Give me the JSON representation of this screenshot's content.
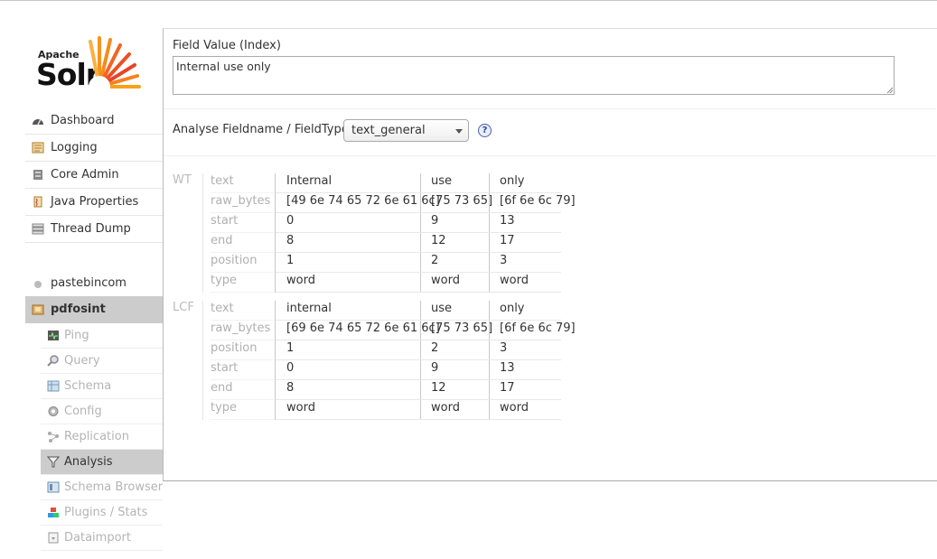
{
  "logo": {
    "apache": "Apache",
    "solr": "Solr"
  },
  "sidebar": {
    "items": [
      {
        "label": "Dashboard",
        "icon": "dashboard-icon"
      },
      {
        "label": "Logging",
        "icon": "logging-icon"
      },
      {
        "label": "Core Admin",
        "icon": "core-admin-icon"
      },
      {
        "label": "Java Properties",
        "icon": "java-properties-icon"
      },
      {
        "label": "Thread Dump",
        "icon": "thread-dump-icon"
      }
    ],
    "cores": [
      {
        "label": "pastebincom"
      },
      {
        "label": "pdfosint"
      }
    ],
    "core_menu": [
      {
        "label": "Ping",
        "icon": "ping-icon"
      },
      {
        "label": "Query",
        "icon": "query-icon"
      },
      {
        "label": "Schema",
        "icon": "schema-icon"
      },
      {
        "label": "Config",
        "icon": "config-icon"
      },
      {
        "label": "Replication",
        "icon": "replication-icon"
      },
      {
        "label": "Analysis",
        "icon": "analysis-icon"
      },
      {
        "label": "Schema Browser",
        "icon": "schema-browser-icon"
      },
      {
        "label": "Plugins / Stats",
        "icon": "plugins-icon"
      },
      {
        "label": "Dataimport",
        "icon": "dataimport-icon"
      }
    ]
  },
  "main": {
    "field_label": "Field Value (Index)",
    "field_value": "Internal use only",
    "fieldtype_label": "Analyse Fieldname / FieldType:",
    "fieldtype_selected": "text_general",
    "help": "?"
  },
  "analysis": [
    {
      "stage": "WT",
      "attributes": [
        "text",
        "raw_bytes",
        "start",
        "end",
        "position",
        "type"
      ],
      "tokens": [
        [
          "Internal",
          "[49 6e 74 65 72 6e 61 6c]",
          "0",
          "8",
          "1",
          "word"
        ],
        [
          "use",
          "[75 73 65]",
          "9",
          "12",
          "2",
          "word"
        ],
        [
          "only",
          "[6f 6e 6c 79]",
          "13",
          "17",
          "3",
          "word"
        ]
      ]
    },
    {
      "stage": "LCF",
      "attributes": [
        "text",
        "raw_bytes",
        "position",
        "start",
        "end",
        "type"
      ],
      "tokens": [
        [
          "internal",
          "[69 6e 74 65 72 6e 61 6c]",
          "1",
          "0",
          "8",
          "word"
        ],
        [
          "use",
          "[75 73 65]",
          "2",
          "9",
          "12",
          "word"
        ],
        [
          "only",
          "[6f 6e 6c 79]",
          "3",
          "13",
          "17",
          "word"
        ]
      ]
    }
  ]
}
